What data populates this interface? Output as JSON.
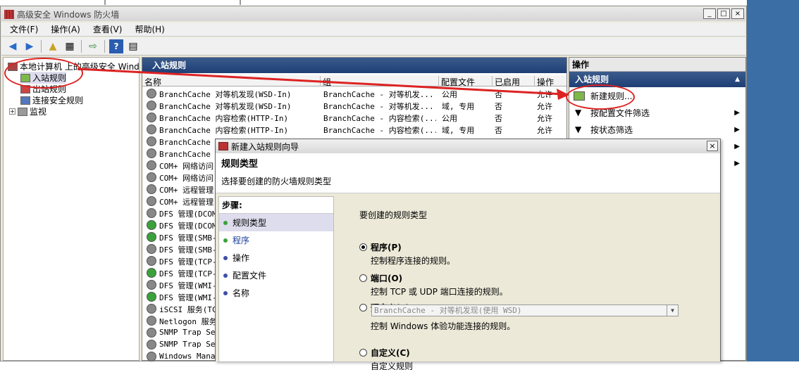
{
  "window": {
    "title": "高级安全 Windows 防火墙",
    "buttons": [
      "_",
      "□",
      "×"
    ]
  },
  "menu": [
    "文件(F)",
    "操作(A)",
    "查看(V)",
    "帮助(H)"
  ],
  "tree": {
    "root": "本地计算机 上的高级安全 Windows",
    "items": [
      "入站规则",
      "出站规则",
      "连接安全规则",
      "监视"
    ],
    "expand": "+"
  },
  "center": {
    "title": "入站规则",
    "columns": [
      "名称",
      "组",
      "配置文件",
      "已启用",
      "操作"
    ],
    "rows": [
      {
        "name": "BranchCache 对等机发现(WSD-In)",
        "group": "BranchCache - 对等机发...",
        "profile": "公用",
        "enabled": "否",
        "action": "允许",
        "on": false
      },
      {
        "name": "BranchCache 对等机发现(WSD-In)",
        "group": "BranchCache - 对等机发...",
        "profile": "域, 专用",
        "enabled": "否",
        "action": "允许",
        "on": false
      },
      {
        "name": "BranchCache 内容检索(HTTP-In)",
        "group": "BranchCache - 内容检索(...",
        "profile": "公用",
        "enabled": "否",
        "action": "允许",
        "on": false
      },
      {
        "name": "BranchCache 内容检索(HTTP-In)",
        "group": "BranchCache - 内容检索(...",
        "profile": "域, 专用",
        "enabled": "否",
        "action": "允许",
        "on": false
      },
      {
        "name": "BranchCache 托",
        "group": "",
        "profile": "",
        "enabled": "",
        "action": "",
        "on": false
      },
      {
        "name": "BranchCache 托",
        "group": "",
        "profile": "",
        "enabled": "",
        "action": "",
        "on": false
      },
      {
        "name": "COM+ 网络访问",
        "group": "",
        "profile": "",
        "enabled": "",
        "action": "",
        "on": false
      },
      {
        "name": "COM+ 网络访问",
        "group": "",
        "profile": "",
        "enabled": "",
        "action": "",
        "on": false
      },
      {
        "name": "COM+ 远程管理",
        "group": "",
        "profile": "",
        "enabled": "",
        "action": "",
        "on": false
      },
      {
        "name": "COM+ 远程管理",
        "group": "",
        "profile": "",
        "enabled": "",
        "action": "",
        "on": false
      },
      {
        "name": "DFS 管理(DCOM-",
        "group": "",
        "profile": "",
        "enabled": "",
        "action": "",
        "on": false
      },
      {
        "name": "DFS 管理(DCOM-",
        "group": "",
        "profile": "",
        "enabled": "",
        "action": "",
        "on": true
      },
      {
        "name": "DFS 管理(SMB-I",
        "group": "",
        "profile": "",
        "enabled": "",
        "action": "",
        "on": true
      },
      {
        "name": "DFS 管理(SMB-I",
        "group": "",
        "profile": "",
        "enabled": "",
        "action": "",
        "on": false
      },
      {
        "name": "DFS 管理(TCP-I",
        "group": "",
        "profile": "",
        "enabled": "",
        "action": "",
        "on": false
      },
      {
        "name": "DFS 管理(TCP-I",
        "group": "",
        "profile": "",
        "enabled": "",
        "action": "",
        "on": true
      },
      {
        "name": "DFS 管理(WMI-I",
        "group": "",
        "profile": "",
        "enabled": "",
        "action": "",
        "on": false
      },
      {
        "name": "DFS 管理(WMI-I",
        "group": "",
        "profile": "",
        "enabled": "",
        "action": "",
        "on": true
      },
      {
        "name": "iSCSI 服务(TCP",
        "group": "",
        "profile": "",
        "enabled": "",
        "action": "",
        "on": false
      },
      {
        "name": "Netlogon 服务",
        "group": "",
        "profile": "",
        "enabled": "",
        "action": "",
        "on": false
      },
      {
        "name": "SNMP Trap Serv",
        "group": "",
        "profile": "",
        "enabled": "",
        "action": "",
        "on": false
      },
      {
        "name": "SNMP Trap Serv",
        "group": "",
        "profile": "",
        "enabled": "",
        "action": "",
        "on": false
      },
      {
        "name": "Windows Manage",
        "group": "",
        "profile": "",
        "enabled": "",
        "action": "",
        "on": false
      }
    ]
  },
  "actions": {
    "title": "操作",
    "section": "入站规则",
    "items": [
      {
        "label": "新建规则...",
        "arrow": ""
      },
      {
        "label": "按配置文件筛选",
        "arrow": "▶"
      },
      {
        "label": "按状态筛选",
        "arrow": "▶"
      }
    ],
    "extra_arrows": [
      "▶",
      "▶"
    ]
  },
  "dialog": {
    "title": "新建入站规则向导",
    "close": "×",
    "heading": "规则类型",
    "subheading": "选择要创建的防火墙规则类型",
    "steps_title": "步骤:",
    "steps": [
      "规则类型",
      "程序",
      "操作",
      "配置文件",
      "名称"
    ],
    "prompt": "要创建的规则类型",
    "options": [
      {
        "label": "程序(P)",
        "desc": "控制程序连接的规则。",
        "checked": true
      },
      {
        "label": "端口(O)",
        "desc": "控制 TCP 或 UDP 端口连接的规则。",
        "checked": false
      },
      {
        "label": "预定义(E):",
        "desc": "控制 Windows 体验功能连接的规则。",
        "checked": false
      },
      {
        "label": "自定义(C)",
        "desc": "自定义规则",
        "checked": false
      }
    ],
    "predefined_value": "BranchCache - 对等机发现(使用 WSD)"
  }
}
